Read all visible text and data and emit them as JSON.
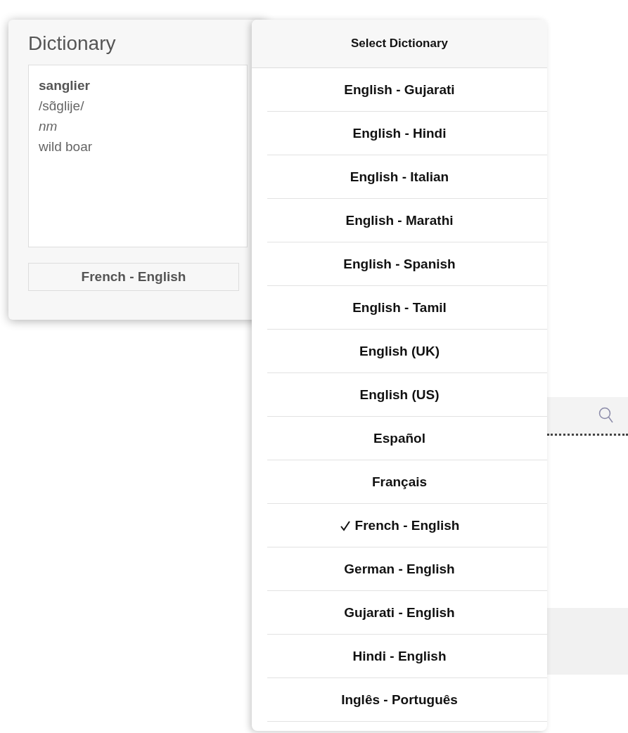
{
  "dictionary_card": {
    "title": "Dictionary",
    "entry": {
      "headword": "sanglier",
      "pronunciation": "/sɑ̃glije/",
      "part_of_speech": "nm",
      "definition": "wild boar"
    },
    "dictionary_button": "French - English"
  },
  "popover": {
    "title": "Select Dictionary",
    "items": [
      {
        "label": "English - Gujarati",
        "selected": false
      },
      {
        "label": "English - Hindi",
        "selected": false
      },
      {
        "label": "English - Italian",
        "selected": false
      },
      {
        "label": "English - Marathi",
        "selected": false
      },
      {
        "label": "English - Spanish",
        "selected": false
      },
      {
        "label": "English - Tamil",
        "selected": false
      },
      {
        "label": "English (UK)",
        "selected": false
      },
      {
        "label": "English (US)",
        "selected": false
      },
      {
        "label": "Español",
        "selected": false
      },
      {
        "label": "Français",
        "selected": false
      },
      {
        "label": "French - English",
        "selected": true
      },
      {
        "label": "German - English",
        "selected": false
      },
      {
        "label": "Gujarati - English",
        "selected": false
      },
      {
        "label": "Hindi - English",
        "selected": false
      },
      {
        "label": "Inglês - Português",
        "selected": false
      }
    ]
  }
}
